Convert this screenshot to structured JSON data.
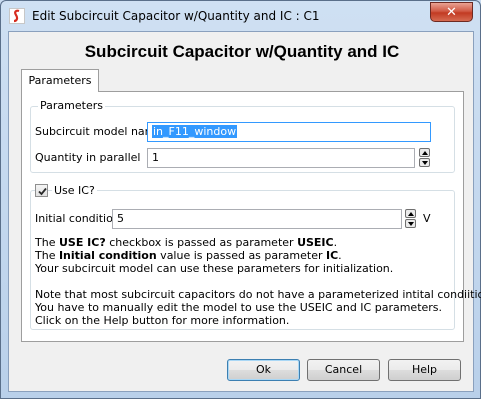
{
  "window": {
    "title": "Edit Subcircuit Capacitor w/Quantity and IC : C1",
    "close_glyph": "✕"
  },
  "dialog": {
    "heading": "Subcircuit Capacitor w/Quantity and IC",
    "tab_label": "Parameters"
  },
  "parameters_group": {
    "title": "Parameters",
    "model_name_label": "Subcircuit model name",
    "model_name_value": "in_F11_window",
    "quantity_label": "Quantity in parallel",
    "quantity_value": "1"
  },
  "ic_group": {
    "use_ic_label": "Use IC?",
    "use_ic_checked": true,
    "initial_condition_label": "Initial condition",
    "initial_condition_value": "5",
    "unit": "V"
  },
  "description": {
    "line1_pre": "The ",
    "line1_b1": "USE IC?",
    "line1_mid": " checkbox is passed as parameter ",
    "line1_b2": "USEIC",
    "line1_post": ".",
    "line2_pre": "The ",
    "line2_b1": "Initial condition",
    "line2_mid": " value is passed as parameter ",
    "line2_b2": "IC",
    "line2_post": ".",
    "line3": "Your subcircuit model can use these parameters for initialization.",
    "line4": "Note that most subcircuit capacitors do not have a parameterized intital condiition.",
    "line5": "You have to manually edit the model to use the USEIC and IC parameters.",
    "line6": "Click on the Help button for more information."
  },
  "buttons": {
    "ok": "Ok",
    "cancel": "Cancel",
    "help": "Help"
  },
  "icons": {
    "app": "simetrix-logo-icon",
    "close": "close-icon",
    "spin_up": "spin-up-icon",
    "spin_down": "spin-down-icon",
    "check": "checkmark-icon"
  },
  "colors": {
    "selection": "#3399ff",
    "close_button": "#c23a22",
    "focus_border": "#3399ff"
  }
}
